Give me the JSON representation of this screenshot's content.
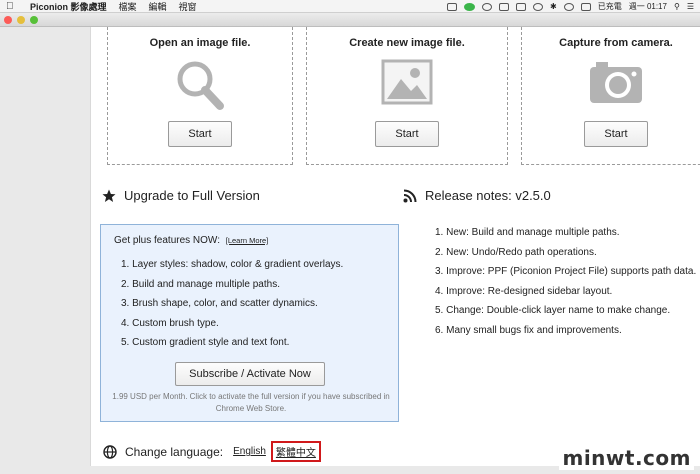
{
  "menubar": {
    "app_name": "Piconion 影像處理",
    "items": [
      "檔案",
      "編輯",
      "視窗"
    ],
    "battery_label": "已充電",
    "clock": "週一 01:17"
  },
  "cards": [
    {
      "title": "Open an image file.",
      "button": "Start",
      "icon": "magnifier-icon"
    },
    {
      "title": "Create new image file.",
      "button": "Start",
      "icon": "image-icon"
    },
    {
      "title": "Capture from camera.",
      "button": "Start",
      "icon": "camera-icon"
    }
  ],
  "upgrade": {
    "title": "Upgrade to Full Version",
    "lead": "Get plus features NOW:",
    "learn_more": "[Learn More]",
    "features": [
      "1. Layer styles: shadow, color & gradient overlays.",
      "2. Build and manage multiple paths.",
      "3. Brush shape, color, and scatter dynamics.",
      "4. Custom brush type.",
      "5. Custom gradient style and text font."
    ],
    "subscribe_button": "Subscribe / Activate Now",
    "fine_print": "1.99 USD per Month. Click to activate the full version if you have subscribed in Chrome Web Store."
  },
  "release_notes": {
    "title": "Release notes: v2.5.0",
    "items": [
      "1. New: Build and manage multiple paths.",
      "2. New: Undo/Redo path operations.",
      "3. Improve: PPF (Piconion Project File) supports path data.",
      "4. Improve: Re-designed sidebar layout.",
      "5. Change: Double-click layer name to make change.",
      "6. Many small bugs fix and improvements."
    ]
  },
  "language": {
    "label": "Change language:",
    "options": [
      "English",
      "繁體中文"
    ],
    "active": "繁體中文"
  },
  "watermark": "minwt.com",
  "colors": {
    "upgrade_bg": "#eaf2fd",
    "upgrade_border": "#8fb3d9",
    "highlight_border": "#d0191b"
  }
}
